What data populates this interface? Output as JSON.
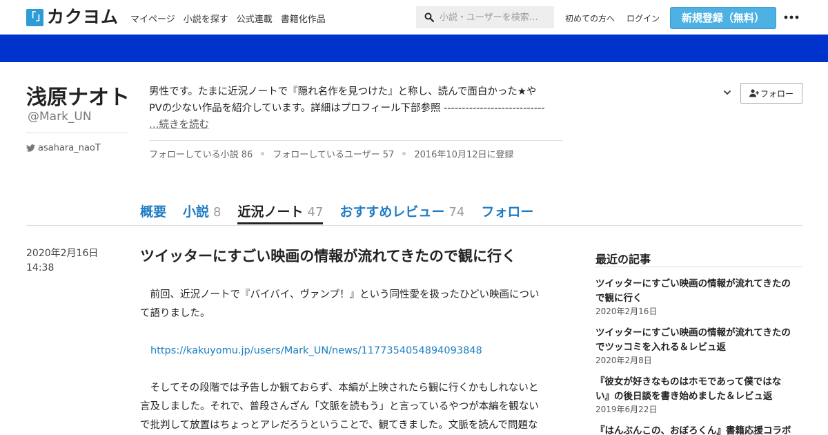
{
  "header": {
    "logo_mark": "「」",
    "logo_text": "カクヨム",
    "nav": [
      "マイページ",
      "小説を探す",
      "公式連載",
      "書籍化作品"
    ],
    "search_placeholder": "小説・ユーザーを検索…",
    "first_time": "初めての方へ",
    "login": "ログイン",
    "register": "新規登録（無料）"
  },
  "colors": {
    "accent": "#2c9bd6",
    "banner": "#0033cc",
    "register": "#4eb1e4",
    "link": "#1e7bc4"
  },
  "profile": {
    "name": "浅原ナオト",
    "id": "@Mark_UN",
    "twitter": "asahara_naoT",
    "bio_line1": "男性です。たまに近況ノートで『隠れ名作を見つけた』と称し、読んで面白かった★や",
    "bio_line2": "PVの少ない作品を紹介しています。詳細はプロフィール下部参照 ----------------------------",
    "bio_more": "…続きを読む",
    "stat_following_novels": "フォローしている小説 86",
    "stat_following_users": "フォローしているユーザー 57",
    "stat_registered": "2016年10月12日に登録",
    "follow_label": "フォロー"
  },
  "tabs": [
    {
      "label": "概要",
      "count": ""
    },
    {
      "label": "小説",
      "count": "8"
    },
    {
      "label": "近況ノート",
      "count": "47"
    },
    {
      "label": "おすすめレビュー",
      "count": "74"
    },
    {
      "label": "フォロー",
      "count": ""
    }
  ],
  "article": {
    "date": "2020年2月16日",
    "time": "14:38",
    "title": "ツイッターにすごい映画の情報が流れてきたので観に行く",
    "p1_line1": "　前回、近況ノートで『バイバイ、ヴァンプ！』という同性愛を扱ったひどい映画につい",
    "p1_line2": "て語りました。",
    "link": "https://kakuyomu.jp/users/Mark_UN/news/1177354054894093848",
    "p2_line1": "　そしてその段階では予告しか観ておらず、本編が上映されたら観に行くかもしれないと",
    "p2_line2": "言及しました。それで、普段さんざん「文脈を読もう」と言っているやつが本編を観ない",
    "p2_line3": "で批判して放置はちょっとアレだろうということで、観てきました。文脈を読んで問題な"
  },
  "sidebar": {
    "heading": "最近の記事",
    "items": [
      {
        "title_line1": "ツイッターにすごい映画の情報が流れてきたの",
        "title_line2": "で観に行く",
        "date": "2020年2月16日"
      },
      {
        "title_line1": "ツイッターにすごい映画の情報が流れてきたの",
        "title_line2": "でツッコミを入れる＆レビュ返",
        "date": "2020年2月8日"
      },
      {
        "title_line1": "『彼女が好きなものはホモであって僕ではな",
        "title_line2": "い』の後日談を書き始めました＆レビュ返",
        "date": "2019年6月22日"
      },
      {
        "title_line1": "『はんぶんこの、おぼろくん』書籍応援コラボ",
        "title_line2": "",
        "date": ""
      }
    ]
  }
}
